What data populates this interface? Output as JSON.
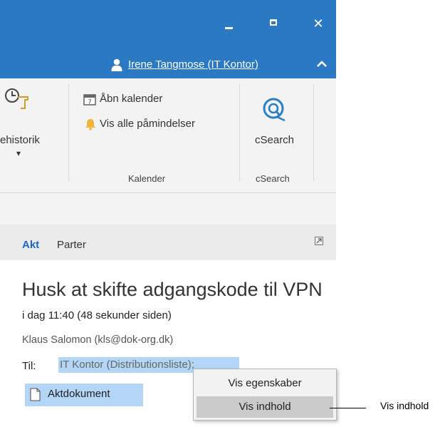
{
  "window_controls": {
    "minimize_label": "Minimize",
    "maximize_label": "Maximize",
    "close_glyph": "✕"
  },
  "user": {
    "name": "Irene Tangmose (IT Kontor)",
    "icon": "person-icon",
    "collapse_icon": "chevron-up-icon"
  },
  "ribbon": {
    "historik": {
      "label": "ehistorik",
      "dropdown_glyph": "▾",
      "icon": "history-icon"
    },
    "kalender": {
      "items": [
        {
          "label": "Åbn kalender",
          "icon": "calendar-icon"
        },
        {
          "label": "Vis alle påmindelser",
          "icon": "bell-icon"
        }
      ],
      "group_label": "Kalender"
    },
    "csearch": {
      "label": "cSearch",
      "group_label": "cSearch",
      "icon": "csearch-icon"
    }
  },
  "tabs": [
    {
      "label": "Akt",
      "active": true
    },
    {
      "label": "Parter",
      "active": false
    }
  ],
  "message": {
    "subject": "Husk at skifte adgangskode til VPN",
    "date": "i dag 11:40 (48 sekunder siden)",
    "sender": "Klaus Salomon (kls@dok-org.dk)",
    "to_label": "Til:",
    "to_value": "IT Kontor (Distributionsliste);",
    "attachment": "Aktdokument"
  },
  "context_menu": {
    "items": [
      {
        "label": "Vis egenskaber",
        "selected": false
      },
      {
        "label": "Vis indhold",
        "selected": true
      }
    ]
  },
  "callout": {
    "label": "Vis indhold"
  },
  "colors": {
    "titlebar": "#2b79c2",
    "ribbon_bg": "#f3f3f3",
    "selection": "#b3d6f6",
    "active_tab": "#1a66c9",
    "menu_highlight": "#cacaca"
  }
}
